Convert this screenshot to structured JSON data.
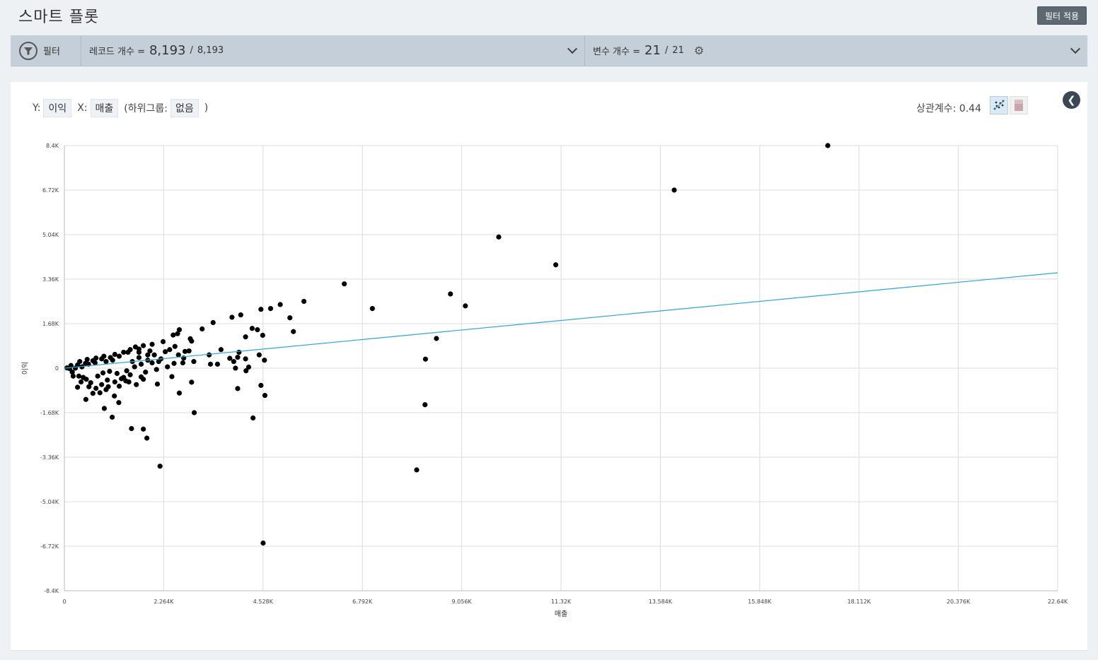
{
  "header": {
    "title": "스마트 플롯",
    "apply_label": "필터 적용"
  },
  "filter_bar": {
    "filter_label": "필터",
    "records_label": "레코드 개수 =",
    "records_shown": "8,193",
    "records_sep": "/",
    "records_total": "8,193",
    "vars_label": "변수 개수 =",
    "vars_shown": "21",
    "vars_sep": "/",
    "vars_total": "21"
  },
  "controls": {
    "y_prefix": "Y:",
    "y_value": "이익",
    "x_prefix": "X:",
    "x_value": "매출",
    "subgroup_prefix": "(하위그룹:",
    "subgroup_value": "없음",
    "subgroup_suffix": ")",
    "correlation": "상관계수: 0.44"
  },
  "chart_data": {
    "type": "scatter",
    "xlabel": "매출",
    "ylabel": "이익",
    "xlim": [
      0,
      22640
    ],
    "ylim": [
      -8400,
      8400
    ],
    "x_ticks": [
      "0",
      "2.264K",
      "4.528K",
      "6.792K",
      "9.056K",
      "11.32K",
      "13.584K",
      "15.848K",
      "18.112K",
      "20.376K",
      "22.64K"
    ],
    "y_ticks": [
      "8.4K",
      "6.72K",
      "5.04K",
      "3.36K",
      "1.68K",
      "0",
      "-1.68K",
      "-3.36K",
      "-5.04K",
      "-6.72K",
      "-8.4K"
    ],
    "trendline": {
      "x": [
        0,
        22640
      ],
      "y": [
        0,
        3600
      ],
      "color": "#29a8d6"
    },
    "point_color": "#000000",
    "points": [
      [
        17400,
        8400
      ],
      [
        13900,
        6720
      ],
      [
        9900,
        4950
      ],
      [
        11200,
        3900
      ],
      [
        6380,
        3180
      ],
      [
        8800,
        2800
      ],
      [
        9140,
        2350
      ],
      [
        7020,
        2250
      ],
      [
        5460,
        2520
      ],
      [
        4920,
        2400
      ],
      [
        4700,
        2250
      ],
      [
        4480,
        2220
      ],
      [
        5140,
        1900
      ],
      [
        5220,
        1380
      ],
      [
        4020,
        2010
      ],
      [
        3820,
        1920
      ],
      [
        8480,
        1120
      ],
      [
        8230,
        340
      ],
      [
        3390,
        1720
      ],
      [
        3140,
        1480
      ],
      [
        2620,
        1450
      ],
      [
        2580,
        1300
      ],
      [
        4400,
        1450
      ],
      [
        4520,
        1240
      ],
      [
        4280,
        1500
      ],
      [
        4130,
        1180
      ],
      [
        2870,
        1110
      ],
      [
        2480,
        1250
      ],
      [
        2900,
        1020
      ],
      [
        2840,
        650
      ],
      [
        2750,
        630
      ],
      [
        3570,
        700
      ],
      [
        3490,
        150
      ],
      [
        3770,
        370
      ],
      [
        3860,
        250
      ],
      [
        3950,
        410
      ],
      [
        3900,
        0
      ],
      [
        4130,
        350
      ],
      [
        4440,
        500
      ],
      [
        4560,
        300
      ],
      [
        4200,
        40
      ],
      [
        4140,
        -100
      ],
      [
        3980,
        600
      ],
      [
        3300,
        500
      ],
      [
        3330,
        150
      ],
      [
        2950,
        250
      ],
      [
        2720,
        380
      ],
      [
        8220,
        -1380
      ],
      [
        8030,
        -3840
      ],
      [
        4530,
        -6600
      ],
      [
        2180,
        -3700
      ],
      [
        1880,
        -2640
      ],
      [
        1800,
        -2300
      ],
      [
        1530,
        -2280
      ],
      [
        1090,
        -1850
      ],
      [
        910,
        -1520
      ],
      [
        2960,
        -1680
      ],
      [
        4300,
        -1880
      ],
      [
        4570,
        -1030
      ],
      [
        4480,
        -650
      ],
      [
        3950,
        -770
      ],
      [
        2620,
        -940
      ],
      [
        2900,
        -530
      ],
      [
        2450,
        -320
      ],
      [
        2120,
        -600
      ],
      [
        1800,
        -420
      ],
      [
        1640,
        -620
      ],
      [
        1240,
        -1300
      ],
      [
        1140,
        -1050
      ],
      [
        950,
        -810
      ],
      [
        810,
        -930
      ],
      [
        490,
        -1180
      ],
      [
        650,
        -950
      ],
      [
        300,
        -720
      ],
      [
        1470,
        -520
      ],
      [
        1350,
        -350
      ],
      [
        980,
        -450
      ],
      [
        2050,
        500
      ],
      [
        2250,
        1000
      ],
      [
        1950,
        650
      ],
      [
        1700,
        400
      ],
      [
        1620,
        800
      ],
      [
        1800,
        850
      ],
      [
        2300,
        620
      ],
      [
        2520,
        820
      ],
      [
        1900,
        300
      ],
      [
        1550,
        250
      ],
      [
        1350,
        600
      ],
      [
        1250,
        450
      ],
      [
        1100,
        300
      ],
      [
        950,
        250
      ],
      [
        700,
        200
      ],
      [
        550,
        150
      ],
      [
        400,
        50
      ],
      [
        250,
        0
      ],
      [
        120,
        -20
      ],
      [
        60,
        10
      ],
      [
        180,
        -150
      ],
      [
        330,
        -300
      ],
      [
        500,
        -420
      ],
      [
        760,
        -300
      ],
      [
        880,
        -180
      ],
      [
        1030,
        -120
      ],
      [
        1200,
        -200
      ],
      [
        1420,
        -100
      ],
      [
        1600,
        50
      ],
      [
        1750,
        150
      ],
      [
        2000,
        200
      ],
      [
        2150,
        250
      ],
      [
        1850,
        -150
      ],
      [
        1500,
        -250
      ],
      [
        1300,
        -400
      ],
      [
        1150,
        -520
      ],
      [
        850,
        -620
      ],
      [
        600,
        -550
      ],
      [
        430,
        -350
      ],
      [
        1050,
        400
      ],
      [
        850,
        350
      ],
      [
        650,
        280
      ],
      [
        480,
        180
      ],
      [
        300,
        120
      ],
      [
        1500,
        700
      ],
      [
        1700,
        600
      ],
      [
        2000,
        900
      ],
      [
        2400,
        700
      ],
      [
        2600,
        500
      ],
      [
        1900,
        500
      ],
      [
        2200,
        350
      ],
      [
        2700,
        200
      ],
      [
        2500,
        180
      ],
      [
        2350,
        50
      ],
      [
        2100,
        -50
      ],
      [
        1750,
        -330
      ],
      [
        1400,
        -480
      ],
      [
        1250,
        -680
      ],
      [
        1000,
        -700
      ],
      [
        720,
        -760
      ],
      [
        560,
        -700
      ],
      [
        380,
        -520
      ],
      [
        200,
        -300
      ],
      [
        150,
        100
      ],
      [
        350,
        250
      ],
      [
        520,
        330
      ],
      [
        720,
        380
      ],
      [
        900,
        450
      ],
      [
        1150,
        520
      ],
      [
        1450,
        600
      ],
      [
        1700,
        720
      ]
    ]
  }
}
